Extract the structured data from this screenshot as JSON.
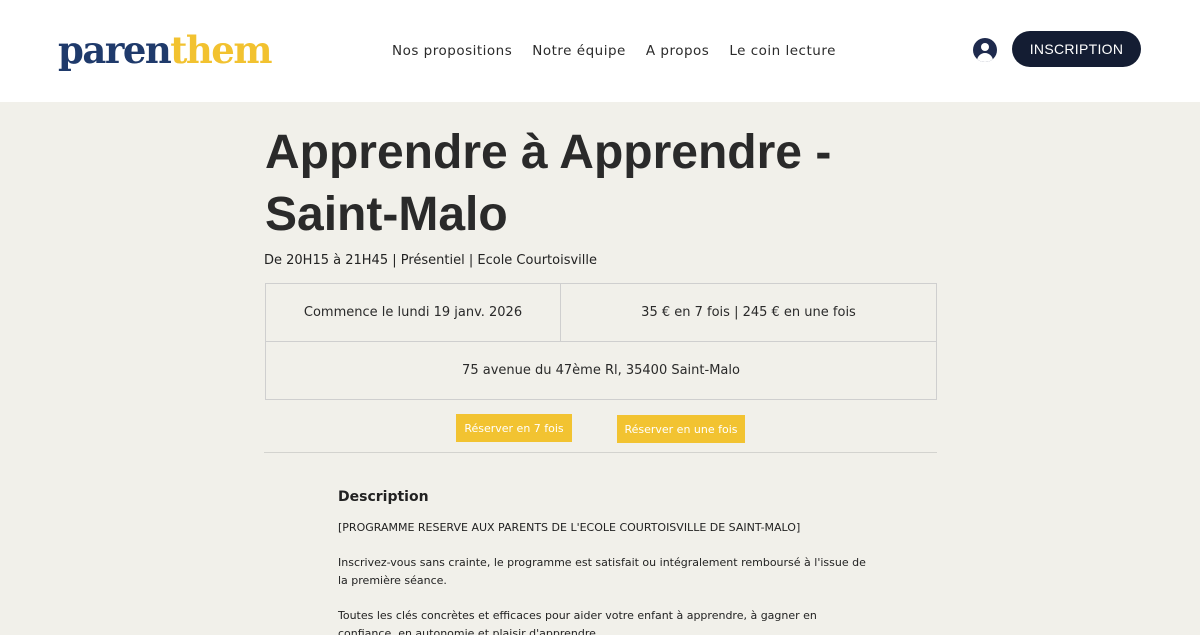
{
  "header": {
    "logo_part1": "paren",
    "logo_part2": "them",
    "nav": [
      "Nos propositions",
      "Notre équipe",
      "A propos",
      "Le coin lecture"
    ],
    "signup_label": "INSCRIPTION"
  },
  "event": {
    "title_line1": "Apprendre à Apprendre -",
    "title_line2": "Saint-Malo",
    "subtitle": "De 20H15 à 21H45 | Présentiel | Ecole Courtoisville",
    "start": "Commence le lundi 19 janv. 2026",
    "price": "35 € en 7 fois | 245 € en une fois",
    "address": "75 avenue du 47ème Rl, 35400 Saint-Malo",
    "book_7_label": "Réserver en 7 fois",
    "book_1_label": "Réserver en une fois"
  },
  "description": {
    "heading": "Description",
    "paragraphs": [
      "[PROGRAMME RESERVE AUX PARENTS DE L'ECOLE COURTOISVILLE DE SAINT-MALO]",
      "Inscrivez-vous sans crainte, le programme est satisfait ou intégralement remboursé à l'issue de la première séance.",
      "Toutes les clés concrètes et efficaces pour aider votre enfant à apprendre, à gagner en confiance, en autonomie et plaisir d'apprendre."
    ]
  },
  "colors": {
    "accent_yellow": "#f2c331",
    "dark_navy": "#141d33",
    "logo_blue": "#1f3a6b",
    "background": "#f1f0ea"
  },
  "icons": {
    "account": "user-account-icon"
  }
}
